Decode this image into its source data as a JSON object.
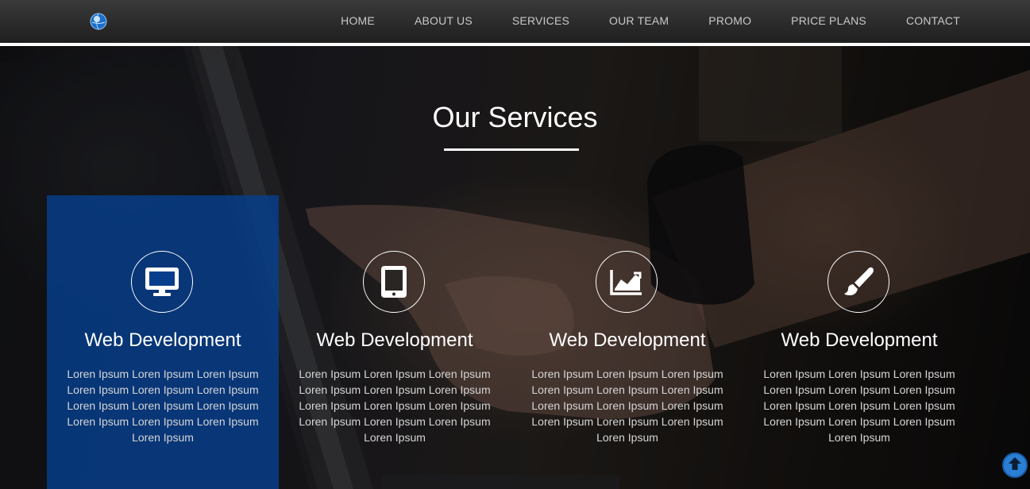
{
  "nav": {
    "logo_icon": "globe-icon",
    "items": [
      {
        "label": "HOME"
      },
      {
        "label": "ABOUT US"
      },
      {
        "label": "SERVICES"
      },
      {
        "label": "OUR TEAM"
      },
      {
        "label": "PROMO"
      },
      {
        "label": "PRICE PLANS"
      },
      {
        "label": "CONTACT"
      }
    ]
  },
  "section": {
    "title": "Our Services"
  },
  "services": [
    {
      "icon": "monitor-icon",
      "title": "Web Development",
      "text": "Loren Ipsum Loren Ipsum Loren Ipsum Loren Ipsum Loren Ipsum Loren Ipsum Loren Ipsum Loren Ipsum Loren Ipsum Loren Ipsum Loren Ipsum Loren Ipsum Loren Ipsum",
      "active": true
    },
    {
      "icon": "tablet-icon",
      "title": "Web Development",
      "text": "Loren Ipsum Loren Ipsum Loren Ipsum Loren Ipsum Loren Ipsum Loren Ipsum Loren Ipsum Loren Ipsum Loren Ipsum Loren Ipsum Loren Ipsum Loren Ipsum Loren Ipsum",
      "active": false
    },
    {
      "icon": "area-chart-icon",
      "title": "Web Development",
      "text": "Loren Ipsum Loren Ipsum Loren Ipsum Loren Ipsum Loren Ipsum Loren Ipsum Loren Ipsum Loren Ipsum Loren Ipsum Loren Ipsum Loren Ipsum Loren Ipsum Loren Ipsum",
      "active": false
    },
    {
      "icon": "paintbrush-icon",
      "title": "Web Development",
      "text": "Loren Ipsum Loren Ipsum Loren Ipsum Loren Ipsum Loren Ipsum Loren Ipsum Loren Ipsum Loren Ipsum Loren Ipsum Loren Ipsum Loren Ipsum Loren Ipsum Loren Ipsum",
      "active": false
    }
  ],
  "scroll_top": {
    "icon": "arrow-up-circle-icon"
  },
  "colors": {
    "active_card": "#063e8c",
    "scroll_button": "#2a7fd4",
    "text": "#ffffff"
  }
}
